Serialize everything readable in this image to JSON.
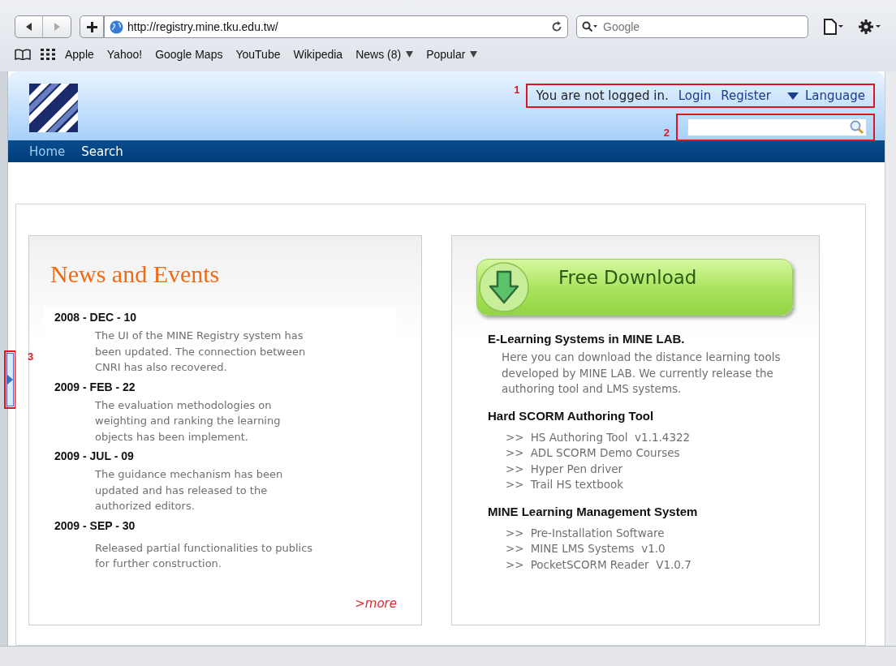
{
  "browser": {
    "address": "http://registry.mine.tku.edu.tw/",
    "search": {
      "placeholder": "Google"
    },
    "bookmarks": [
      {
        "label": "Apple",
        "has_menu": false
      },
      {
        "label": "Yahoo!",
        "has_menu": false
      },
      {
        "label": "Google Maps",
        "has_menu": false
      },
      {
        "label": "YouTube",
        "has_menu": false
      },
      {
        "label": "Wikipedia",
        "has_menu": false
      },
      {
        "label": "News (8)",
        "has_menu": true
      },
      {
        "label": "Popular",
        "has_menu": true
      }
    ]
  },
  "header": {
    "login": {
      "callout": "1",
      "status": "You are not logged in.",
      "links": [
        "Login",
        "Register"
      ],
      "language": "Language"
    },
    "search": {
      "callout": "2"
    },
    "nav": [
      {
        "label": "Home",
        "selected": true
      },
      {
        "label": "Search",
        "selected": false
      }
    ]
  },
  "side_handle": {
    "callout": "3"
  },
  "news": {
    "title": "News and Events",
    "more": ">more",
    "items": [
      {
        "date": "2008 - DEC - 10",
        "text": "The UI of the MINE Registry system has been updated. The connection between CNRI has also recovered."
      },
      {
        "date": "2009 - FEB - 22",
        "text": "The evaluation methodologies on weighting and ranking the learning objects has been implement."
      },
      {
        "date": "2009 - JUL - 09",
        "text": "The guidance mechanism has been updated and has released to the authorized editors."
      },
      {
        "date": "2009 - SEP - 30",
        "text": "Released partial functionalities to publics for further construction."
      }
    ]
  },
  "download": {
    "button": "Free Download",
    "sections": [
      {
        "heading": "E-Learning Systems in MINE LAB.",
        "kind": "paragraph",
        "text": "Here you can download the distance learning tools developed by MINE LAB. We currently release the authoring tool and LMS systems."
      },
      {
        "heading": "Hard SCORM Authoring Tool",
        "kind": "list",
        "items": [
          {
            "marker": ">>",
            "label": "HS Authoring Tool  v1.1.4322"
          },
          {
            "marker": ">>",
            "label": "ADL SCORM Demo Courses"
          },
          {
            "marker": ">>",
            "label": "Hyper Pen driver"
          },
          {
            "marker": ">>",
            "label": "Trail HS textbook"
          }
        ]
      },
      {
        "heading": "MINE Learning Management System",
        "kind": "list",
        "items": [
          {
            "marker": ">>",
            "label": "Pre-Installation Software"
          },
          {
            "marker": ">>",
            "label": "MINE LMS Systems  v1.0"
          },
          {
            "marker": ">>",
            "label": "PocketSCORM Reader  V1.0.7"
          }
        ]
      }
    ]
  }
}
